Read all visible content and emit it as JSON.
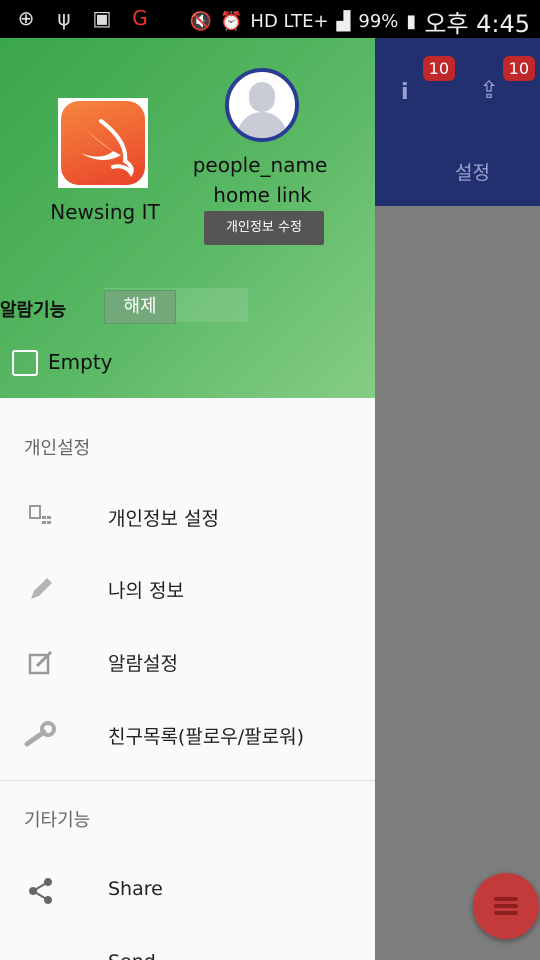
{
  "status_bar": {
    "battery": "99%",
    "time": "오후 4:45",
    "network": "HD LTE+"
  },
  "background_app": {
    "badges": [
      "10",
      "10"
    ],
    "settings_label": "설정"
  },
  "drawer": {
    "org_name": "Newsing IT",
    "people_name": "people_name",
    "home_link": "home link",
    "edit_profile_button": "개인정보 수정",
    "alarm_label": "알람기능",
    "alarm_toggle": "해제",
    "empty_label": "Empty",
    "personal_section": "개인설정",
    "personal_items": [
      {
        "label": "개인정보 설정",
        "icon": "profile-settings-icon"
      },
      {
        "label": "나의 정보",
        "icon": "pencil-icon"
      },
      {
        "label": "알람설정",
        "icon": "edit-box-icon"
      },
      {
        "label": "친구목록(팔로우/팔로워)",
        "icon": "wrench-icon"
      }
    ],
    "other_section": "기타기능",
    "other_items": [
      {
        "label": "Share",
        "icon": "share-icon"
      },
      {
        "label": "Send",
        "icon": "send-icon"
      }
    ]
  },
  "colors": {
    "drawer_header": "#3aa64b",
    "app_header": "#23306f",
    "fab": "#c33a3a",
    "badge": "#c0282b"
  }
}
